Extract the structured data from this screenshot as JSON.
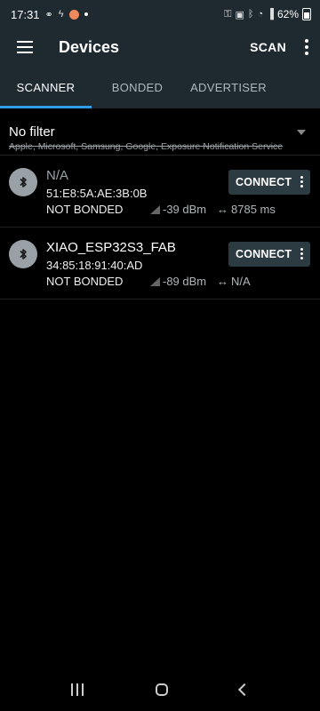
{
  "status_bar": {
    "time": "17:31",
    "battery_text": "62%",
    "icons": [
      "link-icon",
      "signal-icon",
      "orange-dot",
      "dot",
      "key-icon",
      "lock-icon",
      "bluetooth-icon",
      "wifi-icon",
      "cell-signal-icon",
      "battery-icon"
    ]
  },
  "app_bar": {
    "title": "Devices",
    "scan_label": "SCAN"
  },
  "tabs": [
    {
      "label": "SCANNER",
      "active": true
    },
    {
      "label": "BONDED",
      "active": false
    },
    {
      "label": "ADVERTISER",
      "active": false
    }
  ],
  "filter": {
    "title": "No filter",
    "subtitle": "Apple, Microsoft, Samsung, Google, Exposure Notification Service"
  },
  "devices": [
    {
      "name": "N/A",
      "address": "51:E8:5A:AE:3B:0B",
      "bond_state": "NOT BONDED",
      "rssi": "-39 dBm",
      "interval": "8785 ms",
      "connect_label": "CONNECT"
    },
    {
      "name": "XIAO_ESP32S3_FAB",
      "address": "34:85:18:91:40:AD",
      "bond_state": "NOT BONDED",
      "rssi": "-89 dBm",
      "interval": "N/A",
      "connect_label": "CONNECT"
    }
  ],
  "colors": {
    "app_bar": "#1f2a30",
    "tab_indicator": "#2f9de6",
    "connect_button": "#2c3a42",
    "avatar": "#9aa1a6"
  }
}
